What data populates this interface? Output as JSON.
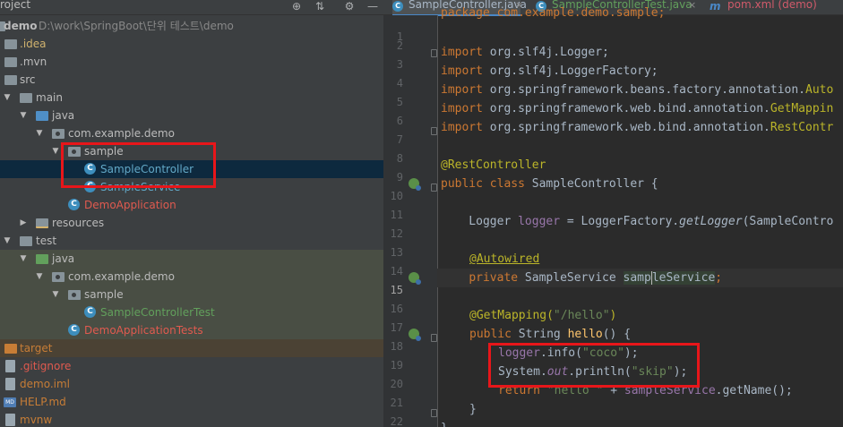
{
  "project": {
    "header_title": "roject",
    "header_icons": [
      "target-icon",
      "collapse-icon",
      "gear-icon",
      "minimize-icon"
    ],
    "tree": [
      {
        "label": "demo",
        "path_hint": "D:\\work\\SpringBoot\\단위 테스트\\demo",
        "icon": "module-folder",
        "bold": true
      },
      {
        "label": ".idea",
        "icon": "folder-grey"
      },
      {
        "label": ".mvn",
        "icon": "folder-grey"
      },
      {
        "label": "src",
        "icon": "folder-grey"
      },
      {
        "label": "main",
        "icon": "folder-grey"
      },
      {
        "label": "java",
        "icon": "folder-blue"
      },
      {
        "label": "com.example.demo",
        "icon": "package"
      },
      {
        "label": "sample",
        "icon": "package"
      },
      {
        "label": "SampleController",
        "icon": "class"
      },
      {
        "label": "SampleService",
        "icon": "class"
      },
      {
        "label": "DemoApplication",
        "icon": "class-run"
      },
      {
        "label": "resources",
        "icon": "folder-resources"
      },
      {
        "label": "test",
        "icon": "folder-grey"
      },
      {
        "label": "java",
        "icon": "folder-green"
      },
      {
        "label": "com.example.demo",
        "icon": "package"
      },
      {
        "label": "sample",
        "icon": "package"
      },
      {
        "label": "SampleControllerTest",
        "icon": "class-test"
      },
      {
        "label": "DemoApplicationTests",
        "icon": "class"
      },
      {
        "label": "target",
        "icon": "folder-orange"
      },
      {
        "label": ".gitignore",
        "icon": "file"
      },
      {
        "label": "demo.iml",
        "icon": "file"
      },
      {
        "label": "HELP.md",
        "icon": "markdown-file"
      },
      {
        "label": "mvnw",
        "icon": "file"
      }
    ]
  },
  "editor": {
    "tabs": [
      {
        "label": "SampleController.java",
        "active": true
      },
      {
        "label": "SampleControllerTest.java",
        "active": false
      },
      {
        "label": "pom.xml (demo)",
        "active": false,
        "icon_letter": "m"
      }
    ],
    "tab_icon_letter": "C",
    "line_numbers": [
      "1",
      "2",
      "3",
      "4",
      "5",
      "6",
      "7",
      "8",
      "9",
      "10",
      "11",
      "12",
      "13",
      "14",
      "15",
      "16",
      "17",
      "18",
      "19",
      "20",
      "21",
      "22",
      "23"
    ],
    "code": {
      "l1": "package com.example.demo.sample;",
      "import_kw": "import",
      "l3": "org.slf4j.Logger;",
      "l4": "org.slf4j.LoggerFactory;",
      "l5a": "org.springframework.beans.factory.annotation.",
      "l5b": "Auto",
      "l6a": "org.springframework.web.bind.annotation.",
      "l6b": "GetMappin",
      "l7a": "org.springframework.web.bind.annotation.",
      "l7b": "RestContr",
      "l9": "@RestController",
      "l10a": "public class",
      "l10b": " SampleController {",
      "l12a": "    Logger ",
      "l12b": "logger",
      "l12c": " = LoggerFactory.",
      "l12d": "getLogger",
      "l12e": "(SampleContro",
      "l14": "@Autowired",
      "l15a": "private",
      "l15b": " SampleService ",
      "l15c": "samp",
      "l15d": "leService",
      "l15e": ";",
      "l17a": "@GetMapping(",
      "l17b": "\"/hello\"",
      "l17c": ")",
      "l18a": "public",
      "l18b": " String ",
      "l18c": "hello",
      "l18d": "() {",
      "l19a": "logger",
      "l19b": ".info(",
      "l19c": "\"coco\"",
      "l19d": ");",
      "l20a": "System.",
      "l20b": "out",
      "l20c": ".println(",
      "l20d": "\"skip\"",
      "l20e": ");",
      "l21a": "return",
      "l21b": " \"hello \"",
      "l21c": " + ",
      "l21d": "sampleService",
      "l21e": ".getName();",
      "l22": "}",
      "l23": "}"
    }
  },
  "colors": {
    "highlight_box": "#e8161a",
    "keyword": "#cc7832",
    "annotation": "#bbb529",
    "string": "#6a8759",
    "field": "#9876aa",
    "method": "#ffc66d"
  }
}
